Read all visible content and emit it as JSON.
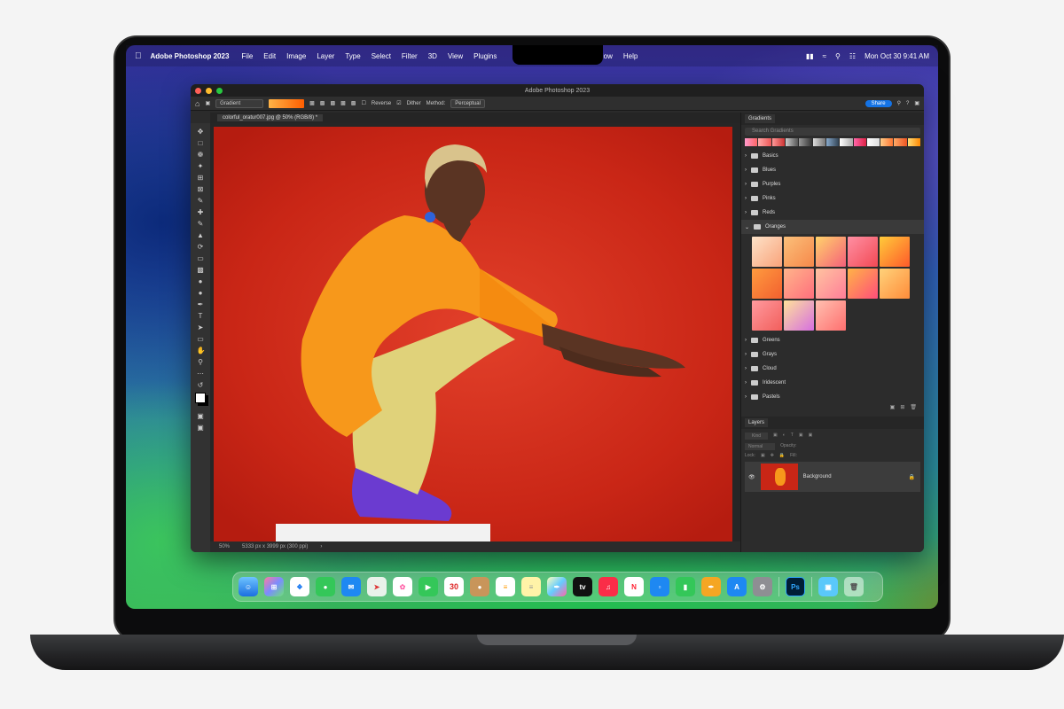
{
  "menubar": {
    "app_name": "Adobe Photoshop 2023",
    "items": [
      "File",
      "Edit",
      "Image",
      "Layer",
      "Type",
      "Select",
      "Filter",
      "3D",
      "View",
      "Plugins",
      "Window",
      "Help"
    ],
    "clock": "Mon Oct 30  9:41 AM"
  },
  "window": {
    "title": "Adobe Photoshop 2023"
  },
  "options_bar": {
    "tool_preset": "Gradient",
    "reverse_label": "Reverse",
    "dither_label": "Dither",
    "method_label": "Method:",
    "method_value": "Perceptual",
    "share_label": "Share"
  },
  "document": {
    "tab_label": "colorful_oratur007.jpg @ 50% (RGB/8) *",
    "zoom": "50%",
    "dimensions": "5333 px x 3999 px (300 ppi)"
  },
  "gradients_panel": {
    "tab_label": "Gradients",
    "search_placeholder": "Search Gradients",
    "folders": [
      "Basics",
      "Blues",
      "Purples",
      "Pinks",
      "Reds",
      "Oranges",
      "Greens",
      "Grays",
      "Cloud",
      "Iridescent",
      "Pastels"
    ],
    "open_folder": "Oranges"
  },
  "layers_panel": {
    "tab_label": "Layers",
    "kind_label": "Kind",
    "blend_mode": "Normal",
    "opacity_label": "Opacity:",
    "lock_label": "Lock:",
    "fill_label": "Fill:",
    "layer_name": "Background"
  },
  "dock": {
    "calendar_date": "30",
    "ps_label": "Ps"
  }
}
